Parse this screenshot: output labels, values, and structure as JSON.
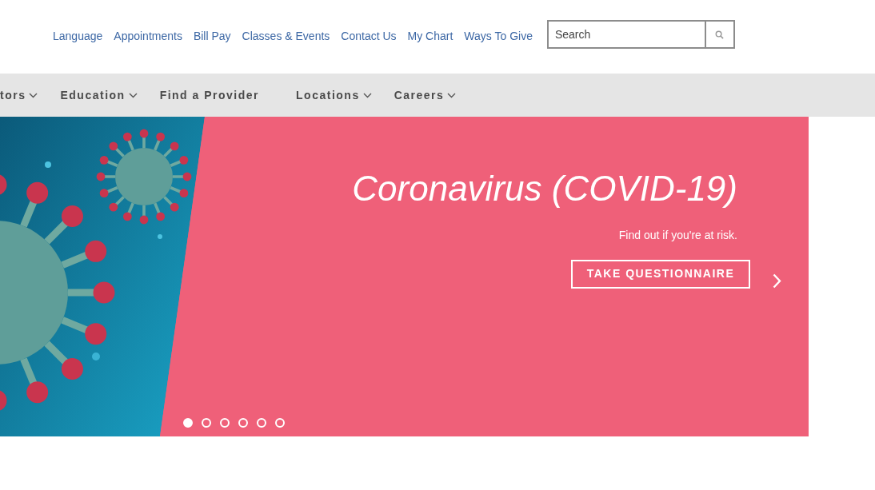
{
  "utility_links": [
    "Language",
    "Appointments",
    "Bill Pay",
    "Classes & Events",
    "Contact Us",
    "My Chart",
    "Ways To Give"
  ],
  "search": {
    "placeholder": "Search"
  },
  "nav": [
    {
      "label": "tors",
      "has_menu": true
    },
    {
      "label": "Education",
      "has_menu": true
    },
    {
      "label": "Find a Provider",
      "has_menu": false
    },
    {
      "label": "Locations",
      "has_menu": true
    },
    {
      "label": "Careers",
      "has_menu": true
    }
  ],
  "hero": {
    "title": "Coronavirus (COVID-19)",
    "subtitle": "Find out if you're at risk.",
    "button": "TAKE QUESTIONNAIRE",
    "slides": [
      {
        "selected": true
      },
      {
        "selected": false
      },
      {
        "selected": false
      },
      {
        "selected": false
      },
      {
        "selected": false
      },
      {
        "selected": false
      }
    ]
  }
}
